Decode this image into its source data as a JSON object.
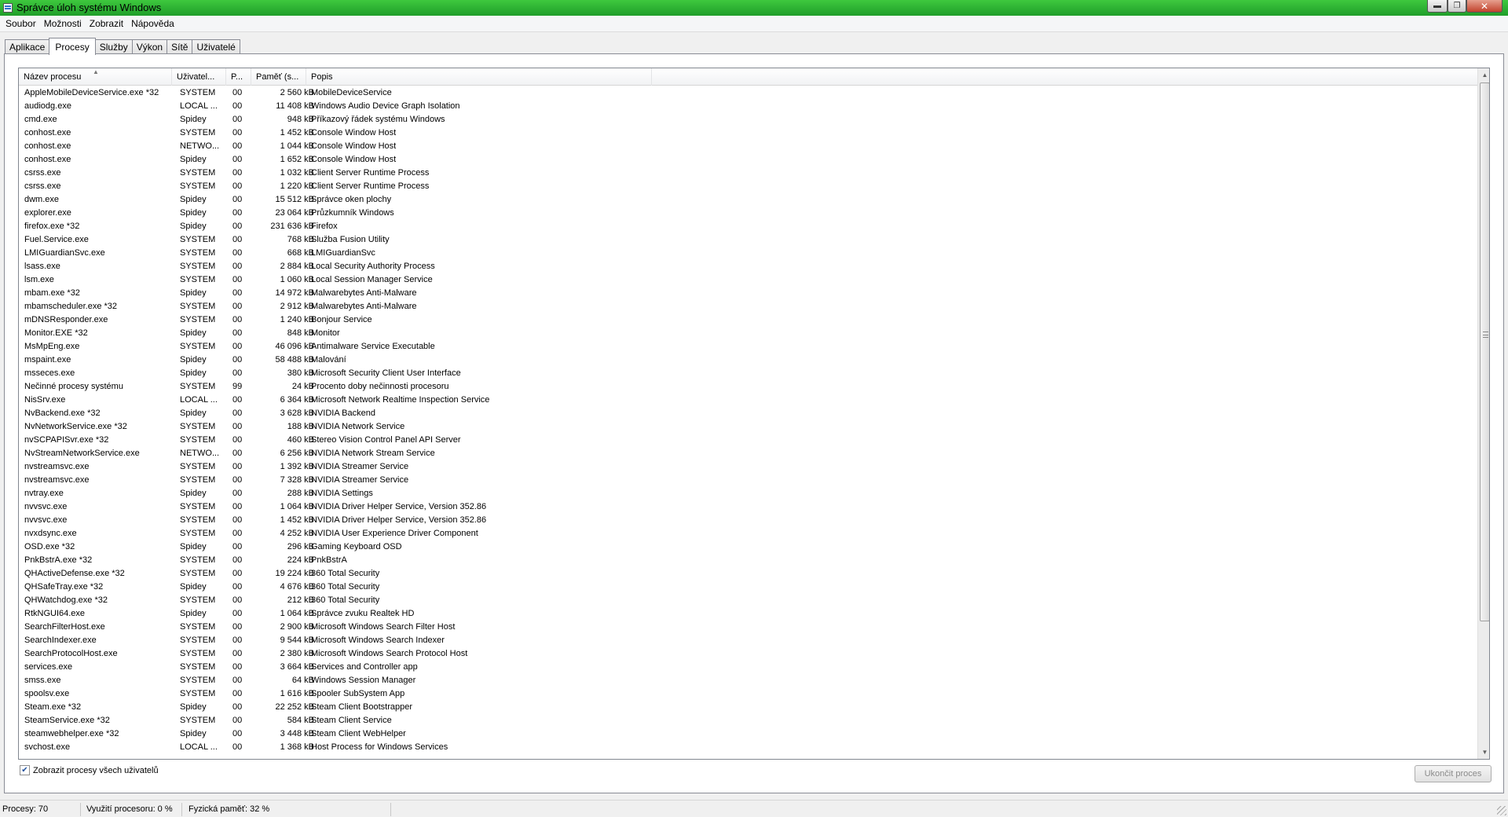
{
  "window": {
    "title": "Správce úloh systému Windows"
  },
  "menu": [
    "Soubor",
    "Možnosti",
    "Zobrazit",
    "Nápověda"
  ],
  "tabs": [
    {
      "label": "Aplikace",
      "active": false
    },
    {
      "label": "Procesy",
      "active": true
    },
    {
      "label": "Služby",
      "active": false
    },
    {
      "label": "Výkon",
      "active": false
    },
    {
      "label": "Sítě",
      "active": false
    },
    {
      "label": "Uživatelé",
      "active": false
    }
  ],
  "table": {
    "columns": [
      "Název procesu",
      "Uživatel...",
      "P...",
      "Paměť (s...",
      "Popis"
    ],
    "rows": [
      [
        "AppleMobileDeviceService.exe *32",
        "SYSTEM",
        "00",
        "2 560 kB",
        "MobileDeviceService"
      ],
      [
        "audiodg.exe",
        "LOCAL ...",
        "00",
        "11 408 kB",
        "Windows Audio Device Graph Isolation"
      ],
      [
        "cmd.exe",
        "Spidey",
        "00",
        "948 kB",
        "Příkazový řádek systému Windows"
      ],
      [
        "conhost.exe",
        "SYSTEM",
        "00",
        "1 452 kB",
        "Console Window Host"
      ],
      [
        "conhost.exe",
        "NETWO...",
        "00",
        "1 044 kB",
        "Console Window Host"
      ],
      [
        "conhost.exe",
        "Spidey",
        "00",
        "1 652 kB",
        "Console Window Host"
      ],
      [
        "csrss.exe",
        "SYSTEM",
        "00",
        "1 032 kB",
        "Client Server Runtime Process"
      ],
      [
        "csrss.exe",
        "SYSTEM",
        "00",
        "1 220 kB",
        "Client Server Runtime Process"
      ],
      [
        "dwm.exe",
        "Spidey",
        "00",
        "15 512 kB",
        "Správce oken plochy"
      ],
      [
        "explorer.exe",
        "Spidey",
        "00",
        "23 064 kB",
        "Průzkumník Windows"
      ],
      [
        "firefox.exe *32",
        "Spidey",
        "00",
        "231 636 kB",
        "Firefox"
      ],
      [
        "Fuel.Service.exe",
        "SYSTEM",
        "00",
        "768 kB",
        "Služba Fusion Utility"
      ],
      [
        "LMIGuardianSvc.exe",
        "SYSTEM",
        "00",
        "668 kB",
        "LMIGuardianSvc"
      ],
      [
        "lsass.exe",
        "SYSTEM",
        "00",
        "2 884 kB",
        "Local Security Authority Process"
      ],
      [
        "lsm.exe",
        "SYSTEM",
        "00",
        "1 060 kB",
        "Local Session Manager Service"
      ],
      [
        "mbam.exe *32",
        "Spidey",
        "00",
        "14 972 kB",
        "Malwarebytes Anti-Malware"
      ],
      [
        "mbamscheduler.exe *32",
        "SYSTEM",
        "00",
        "2 912 kB",
        "Malwarebytes Anti-Malware"
      ],
      [
        "mDNSResponder.exe",
        "SYSTEM",
        "00",
        "1 240 kB",
        "Bonjour Service"
      ],
      [
        "Monitor.EXE *32",
        "Spidey",
        "00",
        "848 kB",
        "Monitor"
      ],
      [
        "MsMpEng.exe",
        "SYSTEM",
        "00",
        "46 096 kB",
        "Antimalware Service Executable"
      ],
      [
        "mspaint.exe",
        "Spidey",
        "00",
        "58 488 kB",
        "Malování"
      ],
      [
        "msseces.exe",
        "Spidey",
        "00",
        "380 kB",
        "Microsoft Security Client User Interface"
      ],
      [
        "Nečinné procesy systému",
        "SYSTEM",
        "99",
        "24 kB",
        "Procento doby nečinnosti procesoru"
      ],
      [
        "NisSrv.exe",
        "LOCAL ...",
        "00",
        "6 364 kB",
        "Microsoft Network Realtime Inspection Service"
      ],
      [
        "NvBackend.exe *32",
        "Spidey",
        "00",
        "3 628 kB",
        "NVIDIA Backend"
      ],
      [
        "NvNetworkService.exe *32",
        "SYSTEM",
        "00",
        "188 kB",
        "NVIDIA Network Service"
      ],
      [
        "nvSCPAPISvr.exe *32",
        "SYSTEM",
        "00",
        "460 kB",
        "Stereo Vision Control Panel API Server"
      ],
      [
        "NvStreamNetworkService.exe",
        "NETWO...",
        "00",
        "6 256 kB",
        "NVIDIA Network Stream Service"
      ],
      [
        "nvstreamsvc.exe",
        "SYSTEM",
        "00",
        "1 392 kB",
        "NVIDIA Streamer Service"
      ],
      [
        "nvstreamsvc.exe",
        "SYSTEM",
        "00",
        "7 328 kB",
        "NVIDIA Streamer Service"
      ],
      [
        "nvtray.exe",
        "Spidey",
        "00",
        "288 kB",
        "NVIDIA Settings"
      ],
      [
        "nvvsvc.exe",
        "SYSTEM",
        "00",
        "1 064 kB",
        "NVIDIA Driver Helper Service, Version 352.86"
      ],
      [
        "nvvsvc.exe",
        "SYSTEM",
        "00",
        "1 452 kB",
        "NVIDIA Driver Helper Service, Version 352.86"
      ],
      [
        "nvxdsync.exe",
        "SYSTEM",
        "00",
        "4 252 kB",
        "NVIDIA User Experience Driver Component"
      ],
      [
        "OSD.exe *32",
        "Spidey",
        "00",
        "296 kB",
        "Gaming Keyboard OSD"
      ],
      [
        "PnkBstrA.exe *32",
        "SYSTEM",
        "00",
        "224 kB",
        "PnkBstrA"
      ],
      [
        "QHActiveDefense.exe *32",
        "SYSTEM",
        "00",
        "19 224 kB",
        "360 Total Security"
      ],
      [
        "QHSafeTray.exe *32",
        "Spidey",
        "00",
        "4 676 kB",
        "360 Total Security"
      ],
      [
        "QHWatchdog.exe *32",
        "SYSTEM",
        "00",
        "212 kB",
        "360 Total Security"
      ],
      [
        "RtkNGUI64.exe",
        "Spidey",
        "00",
        "1 064 kB",
        "Správce zvuku Realtek HD"
      ],
      [
        "SearchFilterHost.exe",
        "SYSTEM",
        "00",
        "2 900 kB",
        "Microsoft Windows Search Filter Host"
      ],
      [
        "SearchIndexer.exe",
        "SYSTEM",
        "00",
        "9 544 kB",
        "Microsoft Windows Search Indexer"
      ],
      [
        "SearchProtocolHost.exe",
        "SYSTEM",
        "00",
        "2 380 kB",
        "Microsoft Windows Search Protocol Host"
      ],
      [
        "services.exe",
        "SYSTEM",
        "00",
        "3 664 kB",
        "Services and Controller app"
      ],
      [
        "smss.exe",
        "SYSTEM",
        "00",
        "64 kB",
        "Windows Session Manager"
      ],
      [
        "spoolsv.exe",
        "SYSTEM",
        "00",
        "1 616 kB",
        "Spooler SubSystem App"
      ],
      [
        "Steam.exe *32",
        "Spidey",
        "00",
        "22 252 kB",
        "Steam Client Bootstrapper"
      ],
      [
        "SteamService.exe *32",
        "SYSTEM",
        "00",
        "584 kB",
        "Steam Client Service"
      ],
      [
        "steamwebhelper.exe *32",
        "Spidey",
        "00",
        "3 448 kB",
        "Steam Client WebHelper"
      ],
      [
        "svchost.exe",
        "LOCAL ...",
        "00",
        "1 368 kB",
        "Host Process for Windows Services"
      ]
    ]
  },
  "show_all_users": {
    "label": "Zobrazit procesy všech uživatelů",
    "checked": true
  },
  "end_process_button": "Ukončit proces",
  "status": {
    "processes": "Procesy: 70",
    "cpu": "Využití procesoru: 0 %",
    "memory": "Fyzická paměť: 32 %"
  }
}
